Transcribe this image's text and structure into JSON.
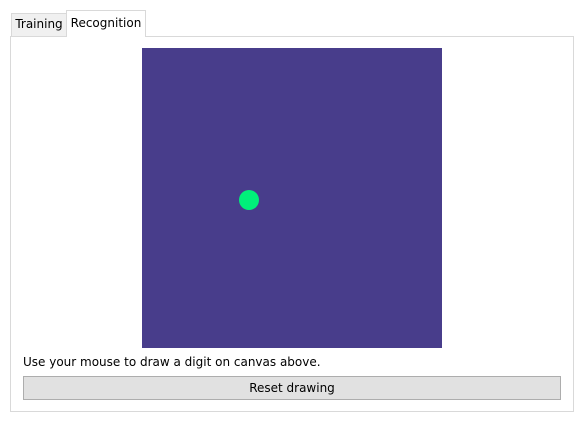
{
  "tabs": {
    "training_label": "Training",
    "recognition_label": "Recognition",
    "active": "Recognition"
  },
  "recognition": {
    "canvas_background": "#483d8b",
    "stroke_color": "#00f07a",
    "instructions": "Use your mouse to draw a digit on canvas above.",
    "reset_label": "Reset drawing"
  }
}
